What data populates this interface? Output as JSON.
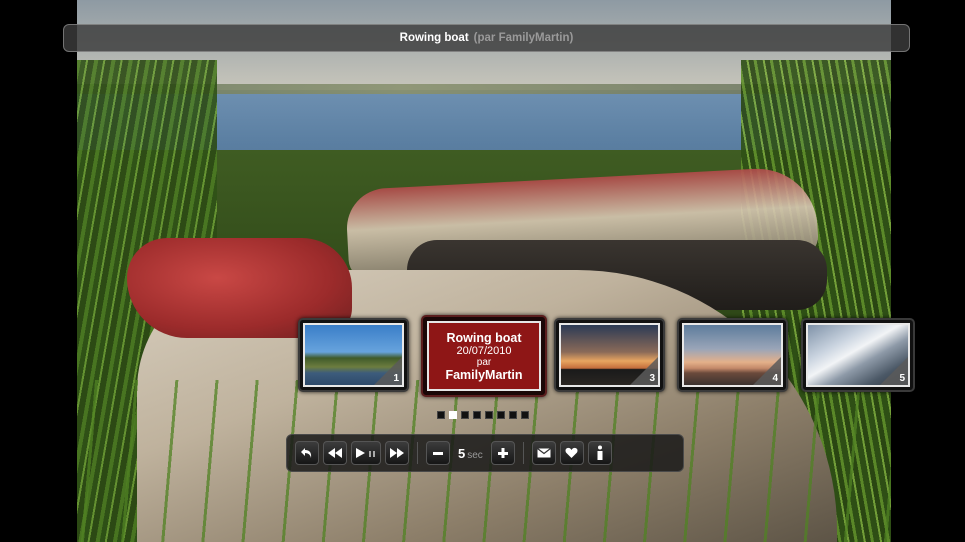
{
  "title_bar": {
    "title": "Rowing boat",
    "credit": "(par FamilyMartin)"
  },
  "thumbnails": [
    {
      "number": "1",
      "state": "normal"
    },
    {
      "state": "active",
      "title": "Rowing boat",
      "date": "20/07/2010",
      "by_label": "par",
      "author": "FamilyMartin"
    },
    {
      "number": "3",
      "state": "normal"
    },
    {
      "number": "4",
      "state": "normal"
    },
    {
      "number": "5",
      "state": "normal"
    }
  ],
  "pagination": {
    "total_pages": 8,
    "current_page": 2
  },
  "controls": {
    "interval_value": "5",
    "interval_unit": "sec",
    "buttons": [
      "back-icon",
      "rewind-icon",
      "play-pause-icon",
      "fast-forward-icon",
      "minus-icon",
      "plus-icon",
      "envelope-icon",
      "heart-icon",
      "info-icon"
    ]
  },
  "colors": {
    "active_thumb": "#8e1616",
    "bar_bg": "#3c3c3c"
  }
}
